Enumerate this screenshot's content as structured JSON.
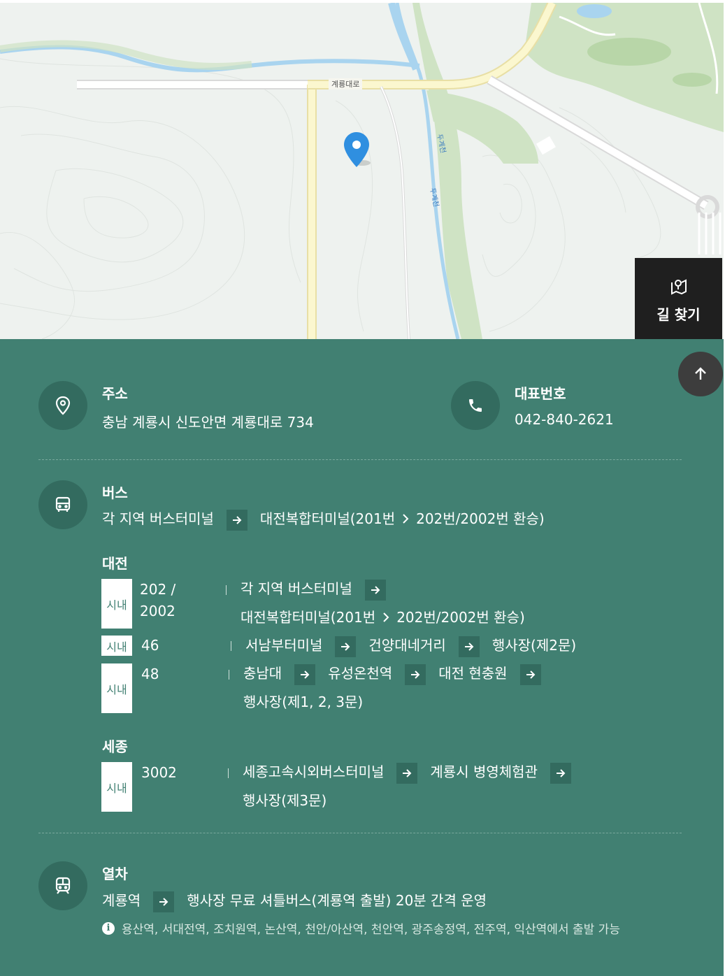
{
  "map": {
    "road_label": "계룡대로",
    "stream_labels": [
      "두계천",
      "두계천"
    ],
    "route_button_label": "길 찾기"
  },
  "address": {
    "title": "주소",
    "value": "충남 계룡시 신도안면 계룡대로 734"
  },
  "phone": {
    "title": "대표번호",
    "value": "042-840-2621"
  },
  "bus": {
    "title": "버스",
    "summary": [
      "각 지역 버스터미널",
      "대전복합터미널(201번",
      "202번/2002번 환승)"
    ],
    "daejeon": {
      "title": "대전",
      "routes": [
        {
          "badge": "시내",
          "number_line1": "202 /",
          "number_line2": "2002",
          "line1": [
            "각 지역 버스터미널"
          ],
          "line2": [
            "대전복합터미널(201번",
            "202번/2002번 환승)"
          ]
        },
        {
          "badge": "시내",
          "number": "46",
          "stops": [
            "서남부터미널",
            "건양대네거리",
            "행사장(제2문)"
          ]
        },
        {
          "badge": "시내",
          "number": "48",
          "stops": [
            "충남대",
            "유성온천역",
            "대전 현충원"
          ],
          "line2": "행사장(제1, 2, 3문)"
        }
      ]
    },
    "sejong": {
      "title": "세종",
      "routes": [
        {
          "badge": "시내",
          "number": "3002",
          "stops": [
            "세종고속시외버스터미널",
            "계룡시 병영체험관"
          ],
          "line2": "행사장(제3문)"
        }
      ]
    }
  },
  "train": {
    "title": "열차",
    "route": [
      "계룡역",
      "행사장 무료 셔틀버스(계룡역 출발) 20분 간격 운영"
    ],
    "note_icon": "i",
    "note": "용산역, 서대전역, 조치원역, 논산역, 천안/아산역, 천안역, 광주송정역, 전주역, 익산역에서 출발 가능"
  },
  "colors": {
    "panel_bg": "#418072",
    "circle_bg": "#336b5f",
    "route_button_bg": "#1f1f1f",
    "pin": "#2f8fe0"
  },
  "icons": [
    "pin-icon",
    "location-icon",
    "phone-icon",
    "bus-icon",
    "train-icon",
    "map-route-icon",
    "arrow-up-icon",
    "arrow-right-icon",
    "chevron-right-icon",
    "info-icon"
  ]
}
